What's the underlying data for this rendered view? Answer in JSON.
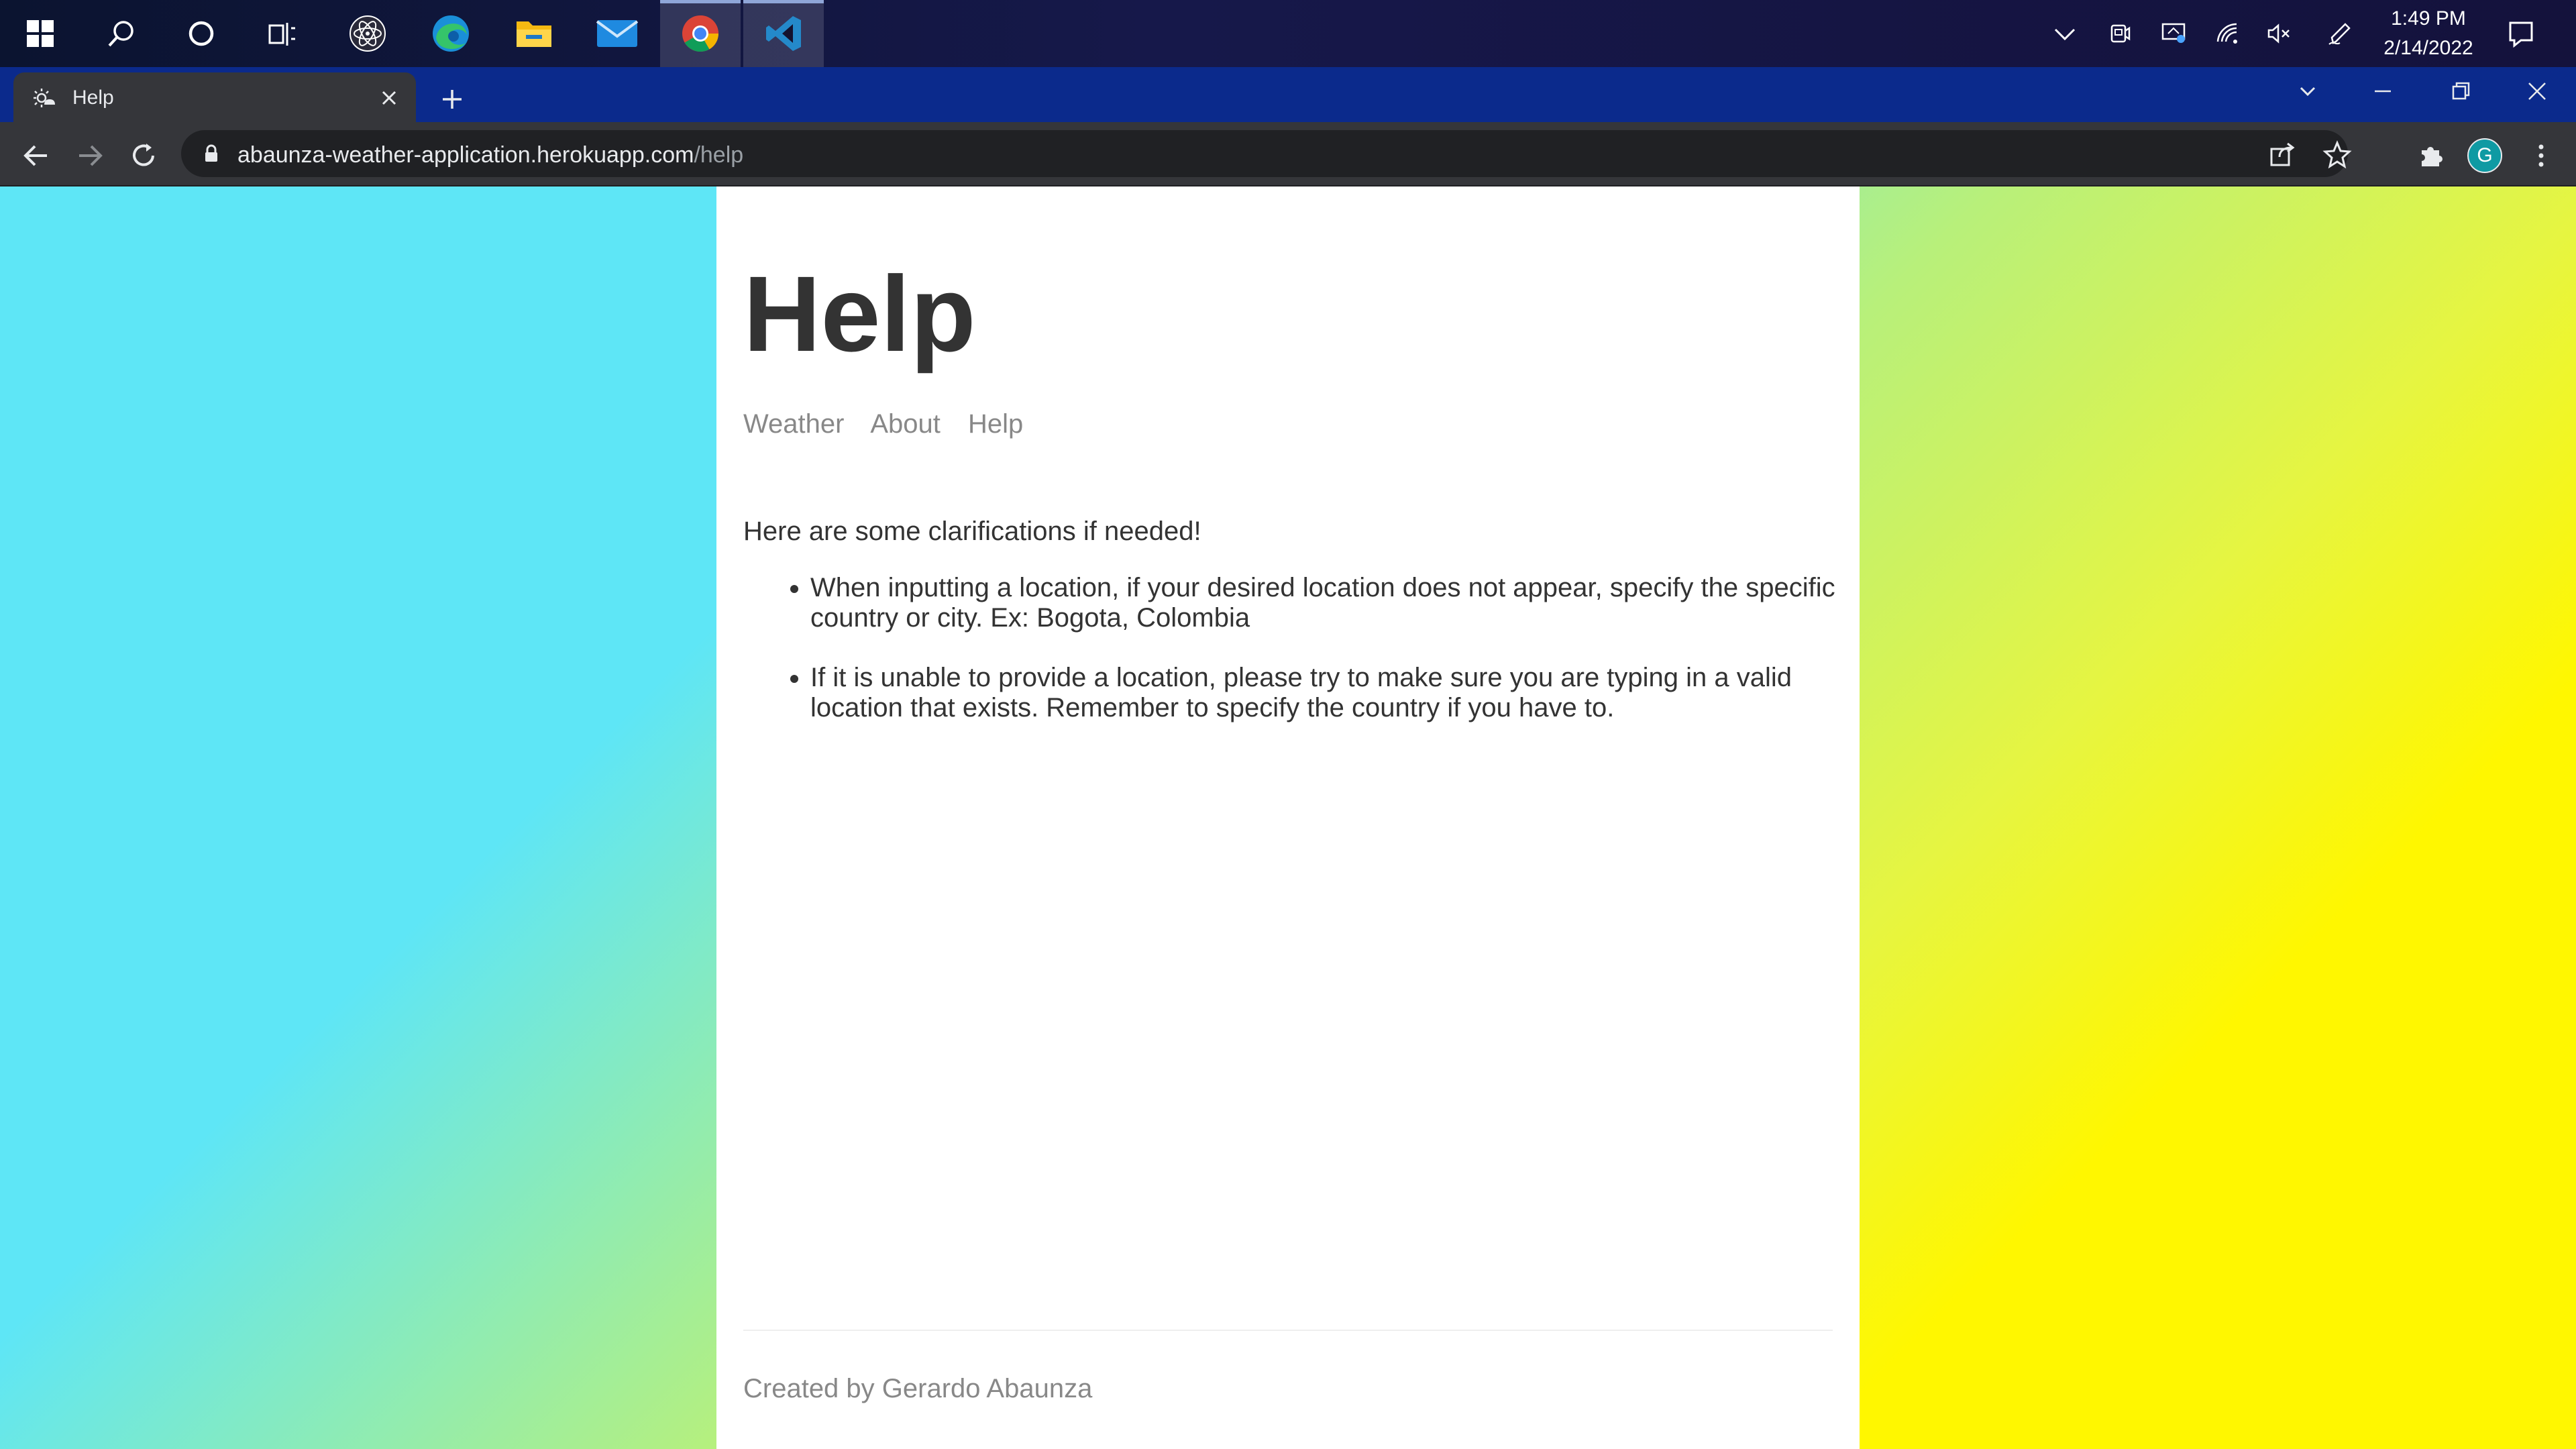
{
  "taskbar": {
    "apps": [
      {
        "name": "start"
      },
      {
        "name": "search"
      },
      {
        "name": "cortana"
      },
      {
        "name": "task-view"
      },
      {
        "name": "react-dev"
      },
      {
        "name": "edge"
      },
      {
        "name": "file-explorer"
      },
      {
        "name": "mail"
      },
      {
        "name": "chrome"
      },
      {
        "name": "vscode"
      }
    ],
    "clock_time": "1:49 PM",
    "clock_date": "2/14/2022"
  },
  "browser": {
    "tab_title": "Help",
    "url_host": "abaunza-weather-application.herokuapp.com",
    "url_path": "/help",
    "profile_initial": "G",
    "accent": "#0b2a8c"
  },
  "page": {
    "title": "Help",
    "nav": [
      "Weather",
      "About",
      "Help"
    ],
    "intro": "Here are some clarifications if needed!",
    "bullets": [
      "When inputting a location, if your desired location does not appear, specify the specific country or city. Ex: Bogota, Colombia",
      "If it is unable to provide a location, please try to make sure you are typing in a valid location that exists. Remember to specify the country if you have to."
    ],
    "footer": "Created by Gerardo Abaunza"
  }
}
